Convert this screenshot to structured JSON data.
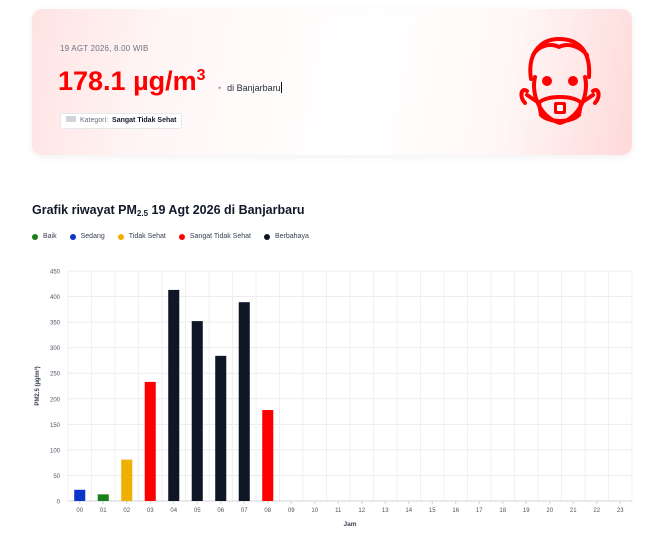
{
  "header": {
    "timestamp": "19 AGT 2026, 8.00 WIB",
    "value_number": "178.1 µg/m",
    "value_superscript": "3",
    "location": "di Banjarbaru",
    "category_prefix": "Kategori:",
    "category_value": "Sangat Tidak Sehat",
    "accent_color": "#ff0000"
  },
  "chart_section": {
    "title_prefix": "Grafik riwayat PM",
    "title_subscript": "2.5",
    "title_suffix": " 19 Agt 2026 di Banjarbaru"
  },
  "legend": [
    {
      "label": "Baik",
      "color": "#1a7f1a"
    },
    {
      "label": "Sedang",
      "color": "#0b35c9"
    },
    {
      "label": "Tidak Sehat",
      "color": "#f0b000"
    },
    {
      "label": "Sangat Tidak Sehat",
      "color": "#ff0000"
    },
    {
      "label": "Berbahaya",
      "color": "#0f1626"
    }
  ],
  "chart_data": {
    "type": "bar",
    "xlabel": "Jam",
    "ylabel": "PM2.5 (µg/m³)",
    "ylim": [
      0,
      450
    ],
    "yticks": [
      0,
      50,
      100,
      150,
      200,
      250,
      300,
      350,
      400,
      450
    ],
    "grid": true,
    "categories": [
      "00",
      "01",
      "02",
      "03",
      "04",
      "05",
      "06",
      "07",
      "08",
      "09",
      "10",
      "11",
      "12",
      "13",
      "14",
      "15",
      "16",
      "17",
      "18",
      "19",
      "20",
      "21",
      "22",
      "23"
    ],
    "values": [
      22,
      13,
      81,
      233,
      413,
      352,
      284,
      389,
      178,
      null,
      null,
      null,
      null,
      null,
      null,
      null,
      null,
      null,
      null,
      null,
      null,
      null,
      null,
      null
    ],
    "bar_colors": [
      "#0b35c9",
      "#1a7f1a",
      "#f0b000",
      "#ff0000",
      "#0f1626",
      "#0f1626",
      "#0f1626",
      "#0f1626",
      "#ff0000",
      null,
      null,
      null,
      null,
      null,
      null,
      null,
      null,
      null,
      null,
      null,
      null,
      null,
      null,
      null
    ]
  }
}
